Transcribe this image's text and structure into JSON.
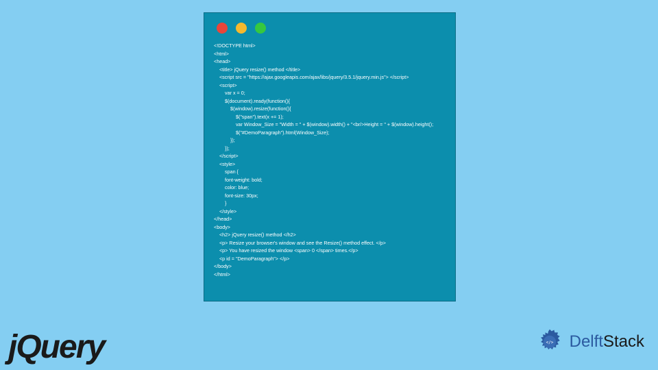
{
  "code_window": {
    "lines": [
      "<!DOCTYPE html>",
      "<html>",
      "<head>",
      "    <title> jQuery resize() method </title>",
      "    <script src = \"https://ajax.googleapis.com/ajax/libs/jquery/3.5.1/jquery.min.js\"> </script>",
      "    <script>",
      "        var x = 0;",
      "        $(document).ready(function(){",
      "            $(window).resize(function(){",
      "                $(\"span\").text(x += 1);",
      "                var Window_Size = \"Width = \" + $(window).width() + \"<br/>Height = \" + $(window).height();",
      "                $(\"#DemoParagraph\").html(Window_Size);",
      "            });",
      "        });",
      "    </script>",
      "    <style>",
      "        span {",
      "        font-weight: bold;",
      "        color: blue;",
      "        font-size: 30px;",
      "        }",
      "    </style>",
      "</head>",
      "<body>",
      "    <h2> jQuery resize() method </h2>",
      "    <p> Resize your browser's window and see the Resize() method effect. </p>",
      "    <p> You have resized the window <span> 0 </span> times.</p>",
      "    <p id = \"DemoParagraph\"> </p>",
      "</body>",
      "</html>"
    ]
  },
  "logos": {
    "jquery": "jQuery",
    "delft_prefix": "Delft",
    "delft_suffix": "Stack"
  }
}
